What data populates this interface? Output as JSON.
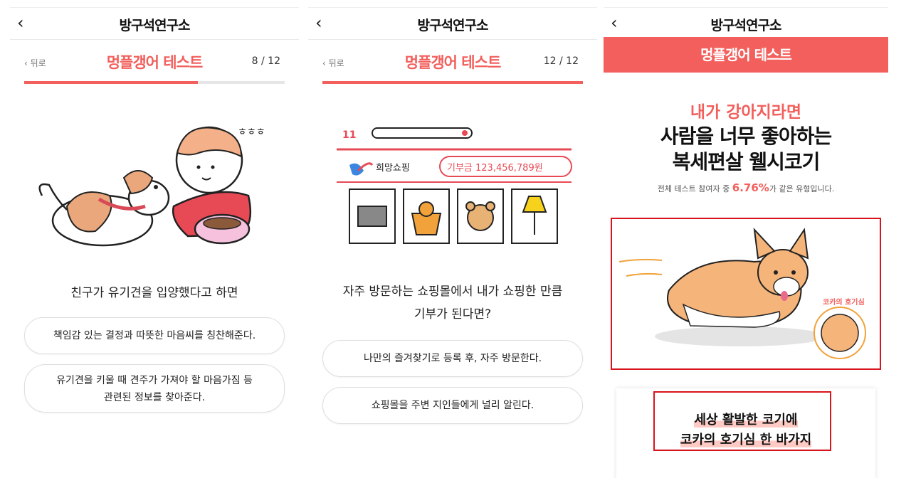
{
  "app": {
    "title": "방구석연구소",
    "back_icon": "chevron-left-icon"
  },
  "colors": {
    "accent": "#f25f5c",
    "highlight_box": "#d8141c"
  },
  "test_title": "멍플갱어 테스트",
  "screens": [
    {
      "prev_label": "뒤로",
      "counter": "8 / 12",
      "progress": 0.6667,
      "question": "친구가 유기견을 입양했다고 하면",
      "options": [
        "책임감 있는 결정과 따뜻한 마음씨를 칭찬해준다.",
        "유기견을 키울 때 견주가 가져야 할 마음가짐 등",
        "관련된 정보를 찾아준다."
      ]
    },
    {
      "prev_label": "뒤로",
      "counter": "12 / 12",
      "progress": 1.0,
      "illustration": {
        "brand": "11",
        "shop_name": "희망쇼핑",
        "donation": "기부금 123,456,789원"
      },
      "question_line1": "자주 방문하는 쇼핑몰에서 내가 쇼핑한 만큼",
      "question_line2": "기부가 된다면?",
      "options": [
        "나만의 즐겨찾기로 등록 후, 자주 방문한다.",
        "쇼핑몰을 주변 지인들에게 널리 알린다."
      ]
    },
    {
      "banner": "멍플갱어 테스트",
      "subtitle": "내가 강아지라면",
      "result_line1": "사람을 너무 좋아하는",
      "result_line2": "복세편살 웰시코기",
      "stat_prefix": "전체 테스트 참여자 중",
      "stat_percent": "6.76%",
      "stat_suffix": "가 같은 유형입니다.",
      "badge_label": "코카의 호기심",
      "desc_line1": "세상 활발한 코기에",
      "desc_line2": "코카의 호기심 한 바가지"
    }
  ]
}
